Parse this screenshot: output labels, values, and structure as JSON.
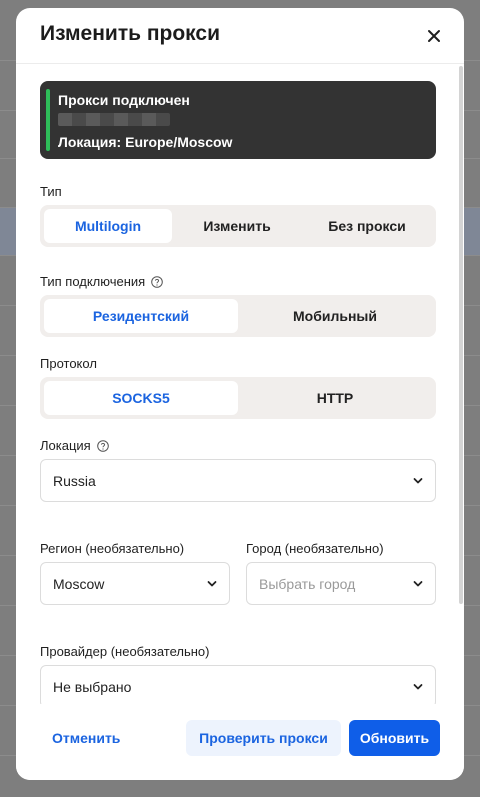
{
  "modal": {
    "title": "Изменить прокси"
  },
  "status": {
    "title": "Прокси подключен",
    "location": "Локация: Europe/Moscow",
    "accent_color": "#2ebd59"
  },
  "type": {
    "label": "Тип",
    "options": [
      "Multilogin",
      "Изменить",
      "Без прокси"
    ],
    "selected": "Multilogin"
  },
  "connection_type": {
    "label": "Тип подключения",
    "options": [
      "Резидентский",
      "Мобильный"
    ],
    "selected": "Резидентский"
  },
  "protocol": {
    "label": "Протокол",
    "options": [
      "SOCKS5",
      "HTTP"
    ],
    "selected": "SOCKS5"
  },
  "location": {
    "label": "Локация",
    "value": "Russia"
  },
  "region": {
    "label": "Регион (необязательно)",
    "value": "Moscow"
  },
  "city": {
    "label": "Город (необязательно)",
    "placeholder": "Выбрать город"
  },
  "provider": {
    "label": "Провайдер (необязательно)",
    "value": "Не выбрано"
  },
  "footer": {
    "cancel": "Отменить",
    "check": "Проверить прокси",
    "update": "Обновить"
  },
  "colors": {
    "accent": "#1b64e0",
    "primary_button": "#0f5ee8",
    "segment_bg": "#f1eeec"
  }
}
